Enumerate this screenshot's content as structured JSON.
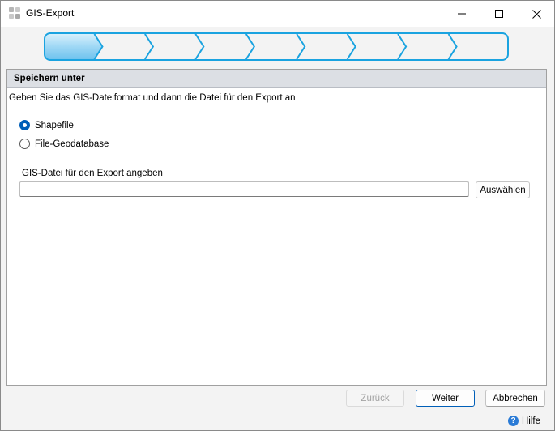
{
  "window": {
    "title": "GIS-Export",
    "icon": "app-grid-icon",
    "controls": {
      "minimize": "minimize-icon",
      "maximize": "maximize-icon",
      "close": "close-icon"
    }
  },
  "wizard": {
    "total_steps": 9,
    "current_step": 1,
    "accent_color": "#1aa3e0",
    "active_fill": "#9fd8f5"
  },
  "panel": {
    "header": "Speichern unter",
    "instruction": "Geben Sie das GIS-Dateiformat und dann die Datei für den Export an",
    "format_options": [
      {
        "label": "Shapefile",
        "selected": true
      },
      {
        "label": "File-Geodatabase",
        "selected": false
      }
    ],
    "file_label": "GIS-Datei für den Export angeben",
    "file_path": "",
    "browse_label": "Auswählen"
  },
  "footer": {
    "back_label": "Zurück",
    "next_label": "Weiter",
    "cancel_label": "Abbrechen",
    "help_label": "Hilfe",
    "help_icon": "question-circle-icon"
  }
}
